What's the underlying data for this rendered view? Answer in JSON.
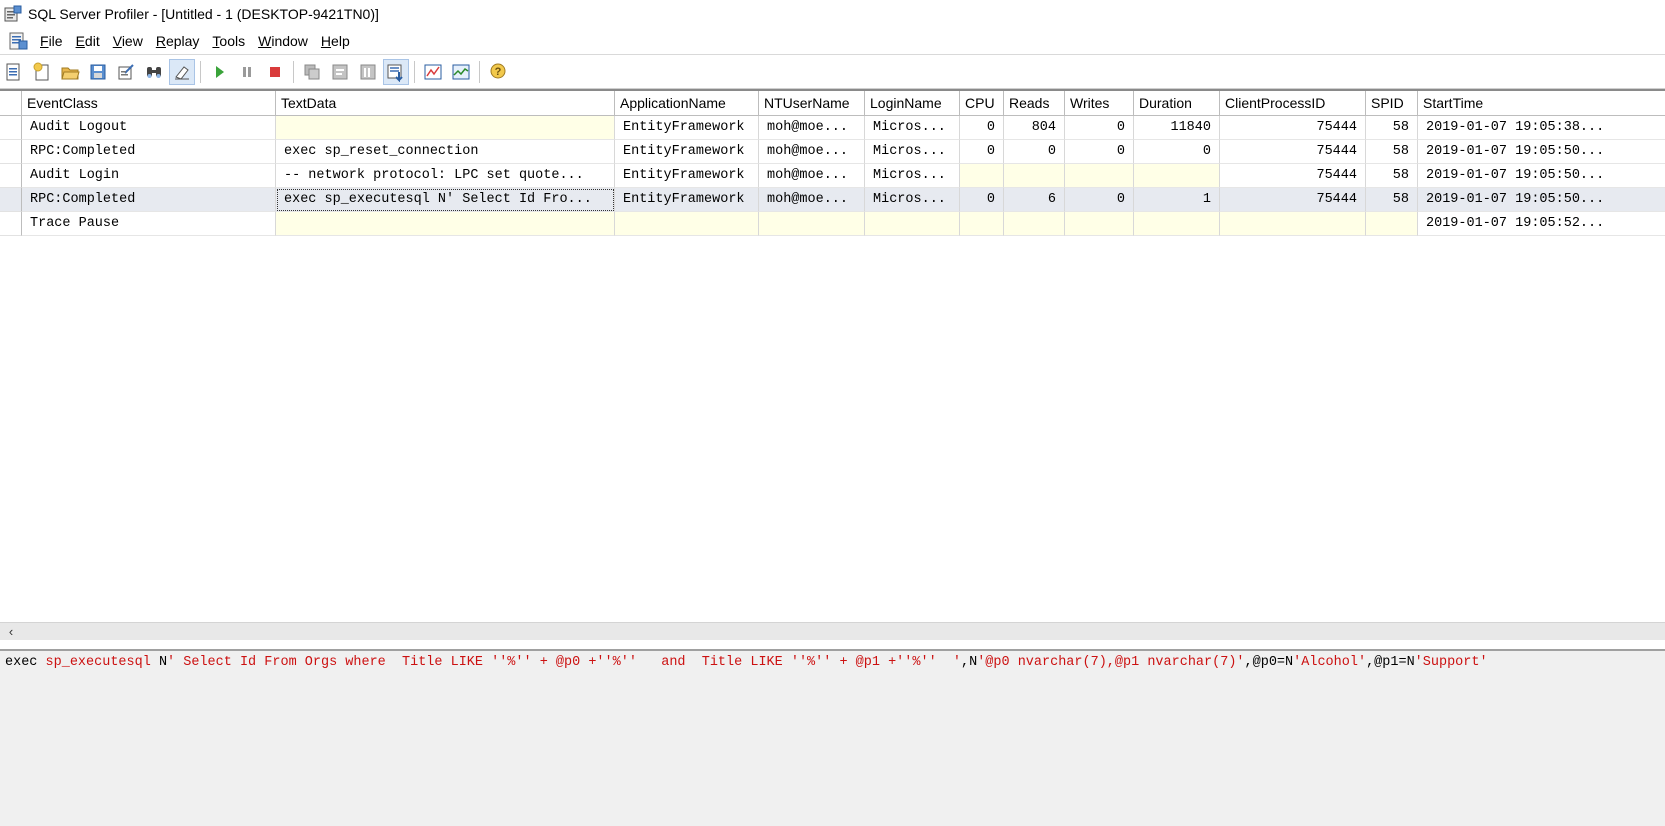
{
  "window": {
    "title": "SQL Server Profiler - [Untitled - 1 (DESKTOP-9421TN0)]",
    "app_icon": "profiler-icon"
  },
  "menu": {
    "doc_icon": "trace-document-icon",
    "items": [
      {
        "label": "File",
        "key": "F"
      },
      {
        "label": "Edit",
        "key": "E"
      },
      {
        "label": "View",
        "key": "V"
      },
      {
        "label": "Replay",
        "key": "R"
      },
      {
        "label": "Tools",
        "key": "T"
      },
      {
        "label": "Window",
        "key": "W"
      },
      {
        "label": "Help",
        "key": "H"
      }
    ]
  },
  "toolbar": {
    "buttons": [
      "new-trace-icon",
      "new-template-icon",
      "open-icon",
      "save-icon",
      "properties-icon",
      "find-icon",
      "clear-trace-icon",
      "run-icon",
      "pause-icon",
      "stop-icon",
      "replay-step-icon",
      "replay-run-icon",
      "replay-cursor-icon",
      "auto-scroll-icon",
      "performance-monitor-icon",
      "activity-monitor-icon",
      "help-icon"
    ]
  },
  "grid": {
    "columns": [
      "EventClass",
      "TextData",
      "ApplicationName",
      "NTUserName",
      "LoginName",
      "CPU",
      "Reads",
      "Writes",
      "Duration",
      "ClientProcessID",
      "SPID",
      "StartTime"
    ],
    "rows": [
      [
        "Audit Logout",
        "",
        "EntityFramework",
        "moh@moe...",
        "Micros...",
        "0",
        "804",
        "0",
        "11840",
        "75444",
        "58",
        "2019-01-07 19:05:38..."
      ],
      [
        "RPC:Completed",
        "exec sp_reset_connection",
        "EntityFramework",
        "moh@moe...",
        "Micros...",
        "0",
        "0",
        "0",
        "0",
        "75444",
        "58",
        "2019-01-07 19:05:50..."
      ],
      [
        "Audit Login",
        "-- network protocol: LPC  set quote...",
        "EntityFramework",
        "moh@moe...",
        "Micros...",
        "",
        "",
        "",
        "",
        "75444",
        "58",
        "2019-01-07 19:05:50..."
      ],
      [
        "RPC:Completed",
        "exec sp_executesql N' Select Id Fro...",
        "EntityFramework",
        "moh@moe...",
        "Micros...",
        "0",
        "6",
        "0",
        "1",
        "75444",
        "58",
        "2019-01-07 19:05:50..."
      ],
      [
        "Trace Pause",
        "",
        "",
        "",
        "",
        "",
        "",
        "",
        "",
        "",
        "",
        "2019-01-07 19:05:52..."
      ]
    ],
    "selected_row": 3
  },
  "scrollbar": {
    "left_arrow": "‹"
  },
  "detail": {
    "parts": [
      {
        "text": "exec ",
        "style": "kw"
      },
      {
        "text": "sp_executesql",
        "style": "red"
      },
      {
        "text": " N",
        "style": "kw"
      },
      {
        "text": "' Select Id From Orgs where  Title LIKE ''%'' + @p0 +''%''   and  Title LIKE ''%'' + @p1 +''%''  '",
        "style": "red"
      },
      {
        "text": ",N",
        "style": "kw"
      },
      {
        "text": "'@p0 nvarchar(7),@p1 nvarchar(7)'",
        "style": "red"
      },
      {
        "text": ",@p0=N",
        "style": "kw"
      },
      {
        "text": "'Alcohol'",
        "style": "red"
      },
      {
        "text": ",@p1=N",
        "style": "kw"
      },
      {
        "text": "'Support'",
        "style": "red"
      }
    ]
  }
}
